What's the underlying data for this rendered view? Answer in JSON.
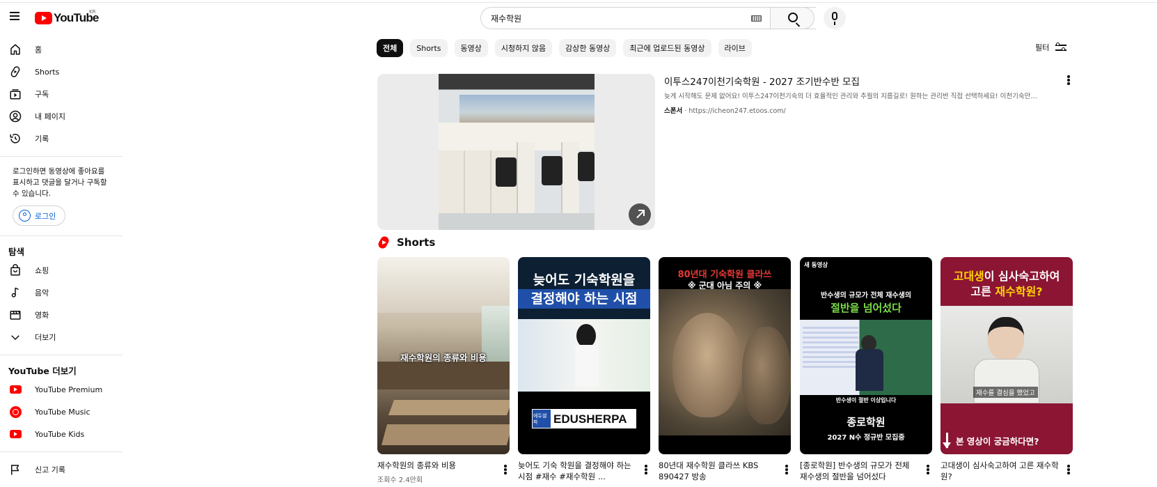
{
  "header": {
    "region": "KR",
    "logo_text": "YouTube",
    "search_value": "재수학원"
  },
  "sidebar": {
    "nav": [
      {
        "label": "홈",
        "icon": "home-icon"
      },
      {
        "label": "Shorts",
        "icon": "shorts-icon"
      },
      {
        "label": "구독",
        "icon": "subscriptions-icon"
      },
      {
        "label": "내 페이지",
        "icon": "account-icon"
      },
      {
        "label": "기록",
        "icon": "history-icon"
      }
    ],
    "login_note": "로그인하면 동영상에 좋아요를 표시하고 댓글을 달거나 구독할 수 있습니다.",
    "login_button": "로그인",
    "explore_title": "탐색",
    "explore": [
      {
        "label": "쇼핑",
        "icon": "shopping-bag-icon"
      },
      {
        "label": "음악",
        "icon": "music-note-icon"
      },
      {
        "label": "영화",
        "icon": "movie-clapper-icon"
      },
      {
        "label": "더보기",
        "icon": "chevron-down-icon"
      }
    ],
    "more_title": "YouTube 더보기",
    "more": [
      {
        "label": "YouTube Premium",
        "icon": "youtube-premium-icon"
      },
      {
        "label": "YouTube Music",
        "icon": "youtube-music-icon"
      },
      {
        "label": "YouTube Kids",
        "icon": "youtube-kids-icon"
      }
    ],
    "report": {
      "label": "신고 기록",
      "icon": "flag-icon"
    }
  },
  "chips": [
    "전체",
    "Shorts",
    "동영상",
    "시청하지 않음",
    "감상한 동영상",
    "최근에 업로드된 동영상",
    "라이브"
  ],
  "filter_label": "필터",
  "ad": {
    "title": "이투스247이천기숙학원 - 2027 조기반수반 모집",
    "description": "늦게 시작해도 문제 없어요! 이투스247이천기숙의 더 효율적인 관리와 추월의 지름길로! 원하는 관리반 직접 선택하세요! 이천기숙만의...",
    "sponsor": "스폰서",
    "url": "https://icheon247.etoos.com/"
  },
  "shorts": {
    "title": "Shorts",
    "items": [
      {
        "caption": "재수학원의 종류와 비용",
        "views": "조회수 2.4만회",
        "overlay": "재수학원의 종류와 비용"
      },
      {
        "caption": "늦어도 기숙 학원을 결정해야 하는 시점 #재수 #재수학원 ...",
        "views": "",
        "overlay_top": "늦어도 기숙학원을",
        "overlay_band": "결정해야 하는 시점",
        "brand": "EDUSHERPA",
        "brand_prefix": "에듀셀파"
      },
      {
        "caption": "80년대 재수학원 클라쓰 KBS 890427 방송",
        "views": "",
        "overlay_top": "80년대 기숙학원 클라쓰",
        "overlay_sub": "※ 군대 아님 주의 ※"
      },
      {
        "caption": "[종로학원] 반수생의 규모가 전체 재수생의 절반을 넘어섰다",
        "views": "",
        "badge": "새 동영상",
        "overlay_top": "반수생의 규모가 전체 재수생의",
        "overlay_hl": "절반을 넘어섰다",
        "overlay_mid": "반수생이 절반 이상입니다",
        "brand": "종로학원",
        "overlay_bottom": "2027 N수 정규반 모집중"
      },
      {
        "caption": "고대생이 심사숙고하여 고른 재수학원?",
        "views": "",
        "overlay_top_hl": "고대생",
        "overlay_top": "이 심사숙고하여",
        "overlay_line2": "고른 ",
        "overlay_line2_hl": "재수학원?",
        "subtitle": "재수를 결심을 했었고",
        "overlay_bottom": "본 영상이 궁금하다면?"
      }
    ]
  },
  "colors": {
    "accent": "#ff0000",
    "link": "#065fd4",
    "chip_active": "#0f0f0f",
    "chip_bg": "#f2f2f2"
  }
}
